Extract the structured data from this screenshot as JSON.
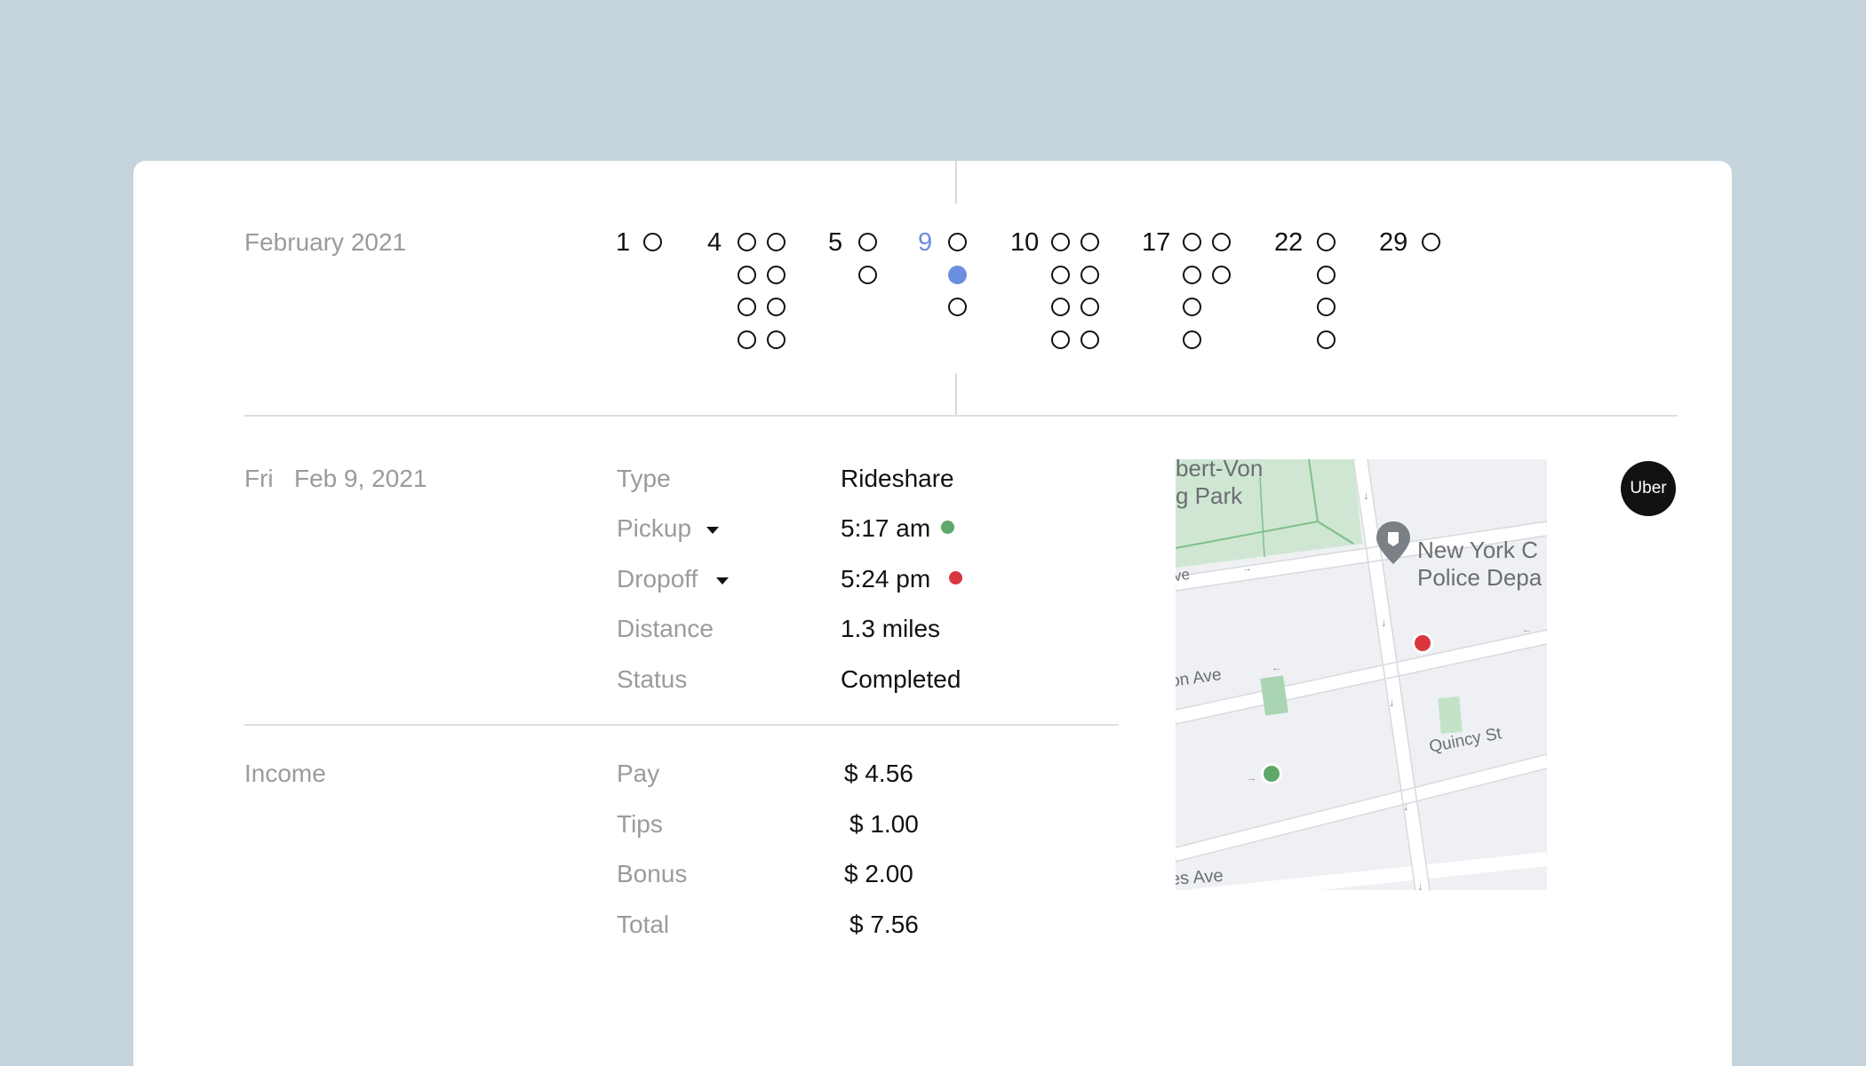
{
  "timeline": {
    "month": "February 2021",
    "days": [
      {
        "day": "1",
        "rides": [
          [
            0
          ]
        ],
        "selected": false
      },
      {
        "day": "4",
        "rides": [
          [
            0,
            0
          ],
          [
            0,
            0
          ],
          [
            0,
            0
          ],
          [
            0,
            0
          ]
        ],
        "selected": false
      },
      {
        "day": "5",
        "rides": [
          [
            0
          ],
          [
            0
          ]
        ],
        "selected": false
      },
      {
        "day": "9",
        "rides": [
          [
            0
          ],
          [
            1
          ],
          [
            0
          ]
        ],
        "selected": true
      },
      {
        "day": "10",
        "rides": [
          [
            0,
            0
          ],
          [
            0,
            0
          ],
          [
            0,
            0
          ],
          [
            0,
            0
          ]
        ],
        "selected": false
      },
      {
        "day": "17",
        "rides": [
          [
            0,
            0
          ],
          [
            0,
            0
          ],
          [
            0
          ],
          [
            0
          ]
        ],
        "selected": false
      },
      {
        "day": "22",
        "rides": [
          [
            0
          ],
          [
            0
          ],
          [
            0
          ],
          [
            0
          ]
        ],
        "selected": false
      },
      {
        "day": "29",
        "rides": [
          [
            0
          ]
        ],
        "selected": false
      }
    ]
  },
  "trip": {
    "weekday": "Fri",
    "date": "Feb 9, 2021",
    "type_label": "Type",
    "type_value": "Rideshare",
    "pickup_label": "Pickup",
    "pickup_value": "5:17 am",
    "dropoff_label": "Dropoff",
    "dropoff_value": "5:24 pm",
    "distance_label": "Distance",
    "distance_value": "1.3 miles",
    "status_label": "Status",
    "status_value": "Completed",
    "pickup_color": "#5ea86a",
    "dropoff_color": "#d9353e"
  },
  "income": {
    "label": "Income",
    "pay_label": "Pay",
    "pay_value": "$ 4.56",
    "tips_label": "Tips",
    "tips_value": "$ 1.00",
    "bonus_label": "Bonus",
    "bonus_value": "$ 2.00",
    "total_label": "Total",
    "total_value": "$ 7.56"
  },
  "map": {
    "park_label_1": "bert-Von",
    "park_label_2": "g Park",
    "place_label_1": "New York C",
    "place_label_2": "Police Depa",
    "street_1": "ve",
    "street_2": "on Ave",
    "street_3": "Quincy St",
    "street_4": "es Ave"
  },
  "badge": "Uber"
}
